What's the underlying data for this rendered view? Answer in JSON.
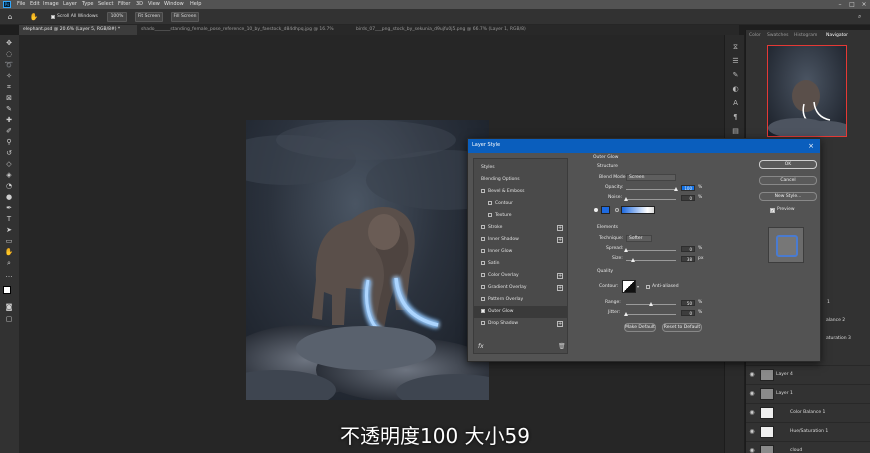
{
  "menubar": {
    "items": [
      "File",
      "Edit",
      "Image",
      "Layer",
      "Type",
      "Select",
      "Filter",
      "3D",
      "View",
      "Window",
      "Help"
    ]
  },
  "options": {
    "scroll_all": "Scroll All Windows",
    "zoom": "100%",
    "fit_screen": "Fit Screen",
    "fill_screen": "Fill Screen"
  },
  "tabs": [
    {
      "label": "elephant.psd @ 20.6% (Layer 5, RGB/8#) *"
    },
    {
      "label": "shado_______standing_female_pose_reference_10_by_faestock_d84dhpq.jpg @ 16.7% (RGB/8)"
    },
    {
      "label": "birds_07___png_stock_by_sekunia_d9ujfu0j5.png @ 66.7% (Layer 1, RGB/8)"
    }
  ],
  "panel_tabs": [
    "Color",
    "Swatches",
    "Histogram",
    "Navigator"
  ],
  "dialog": {
    "title": "Layer Style",
    "styles": [
      {
        "label": "Styles",
        "checkbox": false,
        "plus": false,
        "indent": false
      },
      {
        "label": "Blending Options",
        "checkbox": false,
        "plus": false,
        "indent": false
      },
      {
        "label": "Bevel & Emboss",
        "checkbox": true,
        "plus": false,
        "indent": false
      },
      {
        "label": "Contour",
        "checkbox": true,
        "plus": false,
        "indent": true
      },
      {
        "label": "Texture",
        "checkbox": true,
        "plus": false,
        "indent": true
      },
      {
        "label": "Stroke",
        "checkbox": true,
        "plus": true,
        "indent": false
      },
      {
        "label": "Inner Shadow",
        "checkbox": true,
        "plus": true,
        "indent": false
      },
      {
        "label": "Inner Glow",
        "checkbox": true,
        "plus": false,
        "indent": false
      },
      {
        "label": "Satin",
        "checkbox": true,
        "plus": false,
        "indent": false
      },
      {
        "label": "Color Overlay",
        "checkbox": true,
        "plus": true,
        "indent": false
      },
      {
        "label": "Gradient Overlay",
        "checkbox": true,
        "plus": true,
        "indent": false
      },
      {
        "label": "Pattern Overlay",
        "checkbox": true,
        "plus": false,
        "indent": false
      },
      {
        "label": "Outer Glow",
        "checkbox": true,
        "plus": false,
        "indent": false,
        "selected": true
      },
      {
        "label": "Drop Shadow",
        "checkbox": true,
        "plus": true,
        "indent": false
      }
    ],
    "section_title": "Outer Glow",
    "structure_label": "Structure",
    "blend_mode_label": "Blend Mode:",
    "blend_mode_value": "Screen",
    "opacity_label": "Opacity:",
    "opacity_value": "100",
    "noise_label": "Noise:",
    "noise_value": "0",
    "percent": "%",
    "px": "px",
    "elements_label": "Elements",
    "technique_label": "Technique:",
    "technique_value": "Softer",
    "spread_label": "Spread:",
    "spread_value": "0",
    "size_label": "Size:",
    "size_value": "38",
    "quality_label": "Quality",
    "contour_label": "Contour:",
    "anti_aliased_label": "Anti-aliased",
    "range_label": "Range:",
    "range_value": "50",
    "jitter_label": "Jitter:",
    "jitter_value": "0",
    "make_default": "Make Default",
    "reset_default": "Reset to Default",
    "ok": "OK",
    "cancel": "Cancel",
    "new_style": "New Style...",
    "preview": "Preview",
    "glow_color": "#1e6ae0",
    "opacity_level": 1.0,
    "noise_level": 0.0,
    "spread_level": 0.0,
    "size_level": 0.15,
    "range_level": 0.5,
    "jitter_level": 0.0
  },
  "layers": [
    {
      "name": "Layer 4"
    },
    {
      "name": "Layer 1"
    },
    {
      "name": "Color Balance 1"
    },
    {
      "name": "Hue/Saturation 1"
    },
    {
      "name": "cloud"
    }
  ],
  "partial_labels": [
    "1",
    "alance 2",
    "aturation 3"
  ],
  "caption": "不透明度100 大小59"
}
